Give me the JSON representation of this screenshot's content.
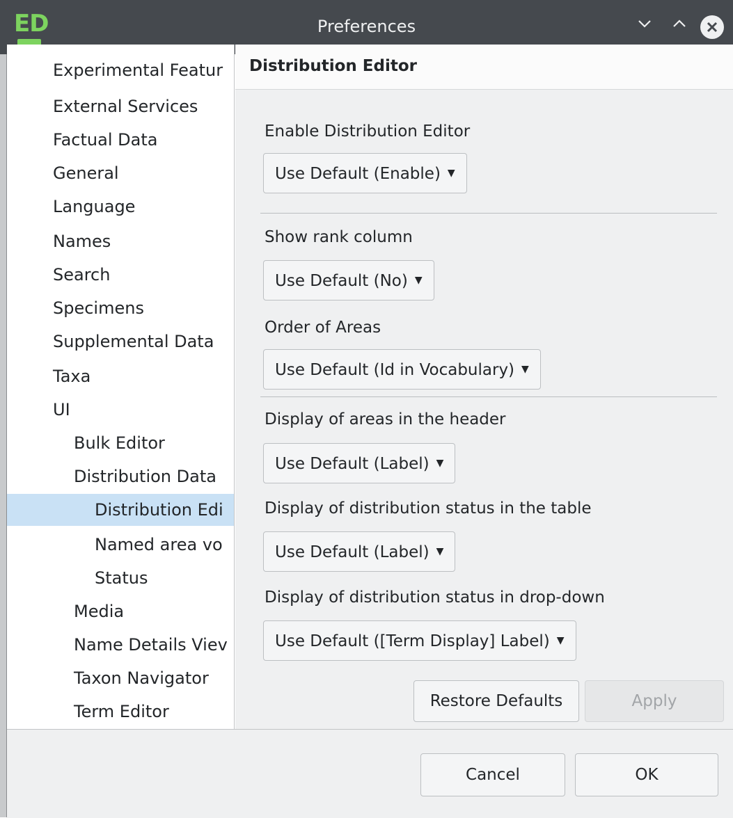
{
  "window": {
    "app_icon": "ED",
    "title": "Preferences",
    "minimize_icon": "chevron-down-icon",
    "maximize_icon": "chevron-up-icon",
    "close_icon": "close-circle-icon"
  },
  "tree": {
    "items": [
      {
        "label": "Experimental Featur",
        "level": 0
      },
      {
        "label": "External Services",
        "level": 0
      },
      {
        "label": "Factual Data",
        "level": 0
      },
      {
        "label": "General",
        "level": 0
      },
      {
        "label": "Language",
        "level": 0
      },
      {
        "label": "Names",
        "level": 0
      },
      {
        "label": "Search",
        "level": 0
      },
      {
        "label": "Specimens",
        "level": 0
      },
      {
        "label": "Supplemental Data",
        "level": 0
      },
      {
        "label": "Taxa",
        "level": 0
      },
      {
        "label": "UI",
        "level": 0
      },
      {
        "label": "Bulk Editor",
        "level": 1
      },
      {
        "label": "Distribution Data",
        "level": 1
      },
      {
        "label": "Distribution Edi",
        "level": 2,
        "selected": true
      },
      {
        "label": "Named area vo",
        "level": 2
      },
      {
        "label": "Status",
        "level": 2
      },
      {
        "label": "Media",
        "level": 1
      },
      {
        "label": "Name Details Viev",
        "level": 1
      },
      {
        "label": "Taxon Navigator",
        "level": 1
      },
      {
        "label": "Term Editor",
        "level": 1
      }
    ]
  },
  "panel": {
    "title": "Distribution Editor",
    "settings": [
      {
        "label": "Enable Distribution Editor",
        "value": "Use Default (Enable)"
      },
      {
        "label": "Show rank column",
        "value": "Use Default (No)"
      },
      {
        "label": "Order of Areas",
        "value": "Use Default (Id in Vocabulary)"
      },
      {
        "label": "Display of areas in the header",
        "value": "Use Default (Label)"
      },
      {
        "label": "Display of distribution status in the table",
        "value": "Use Default (Label)"
      },
      {
        "label": "Display of distribution status in drop-down",
        "value": "Use Default ([Term Display] Label)"
      }
    ],
    "restore_defaults_label": "Restore Defaults",
    "apply_label": "Apply"
  },
  "footer": {
    "cancel_label": "Cancel",
    "ok_label": "OK"
  }
}
